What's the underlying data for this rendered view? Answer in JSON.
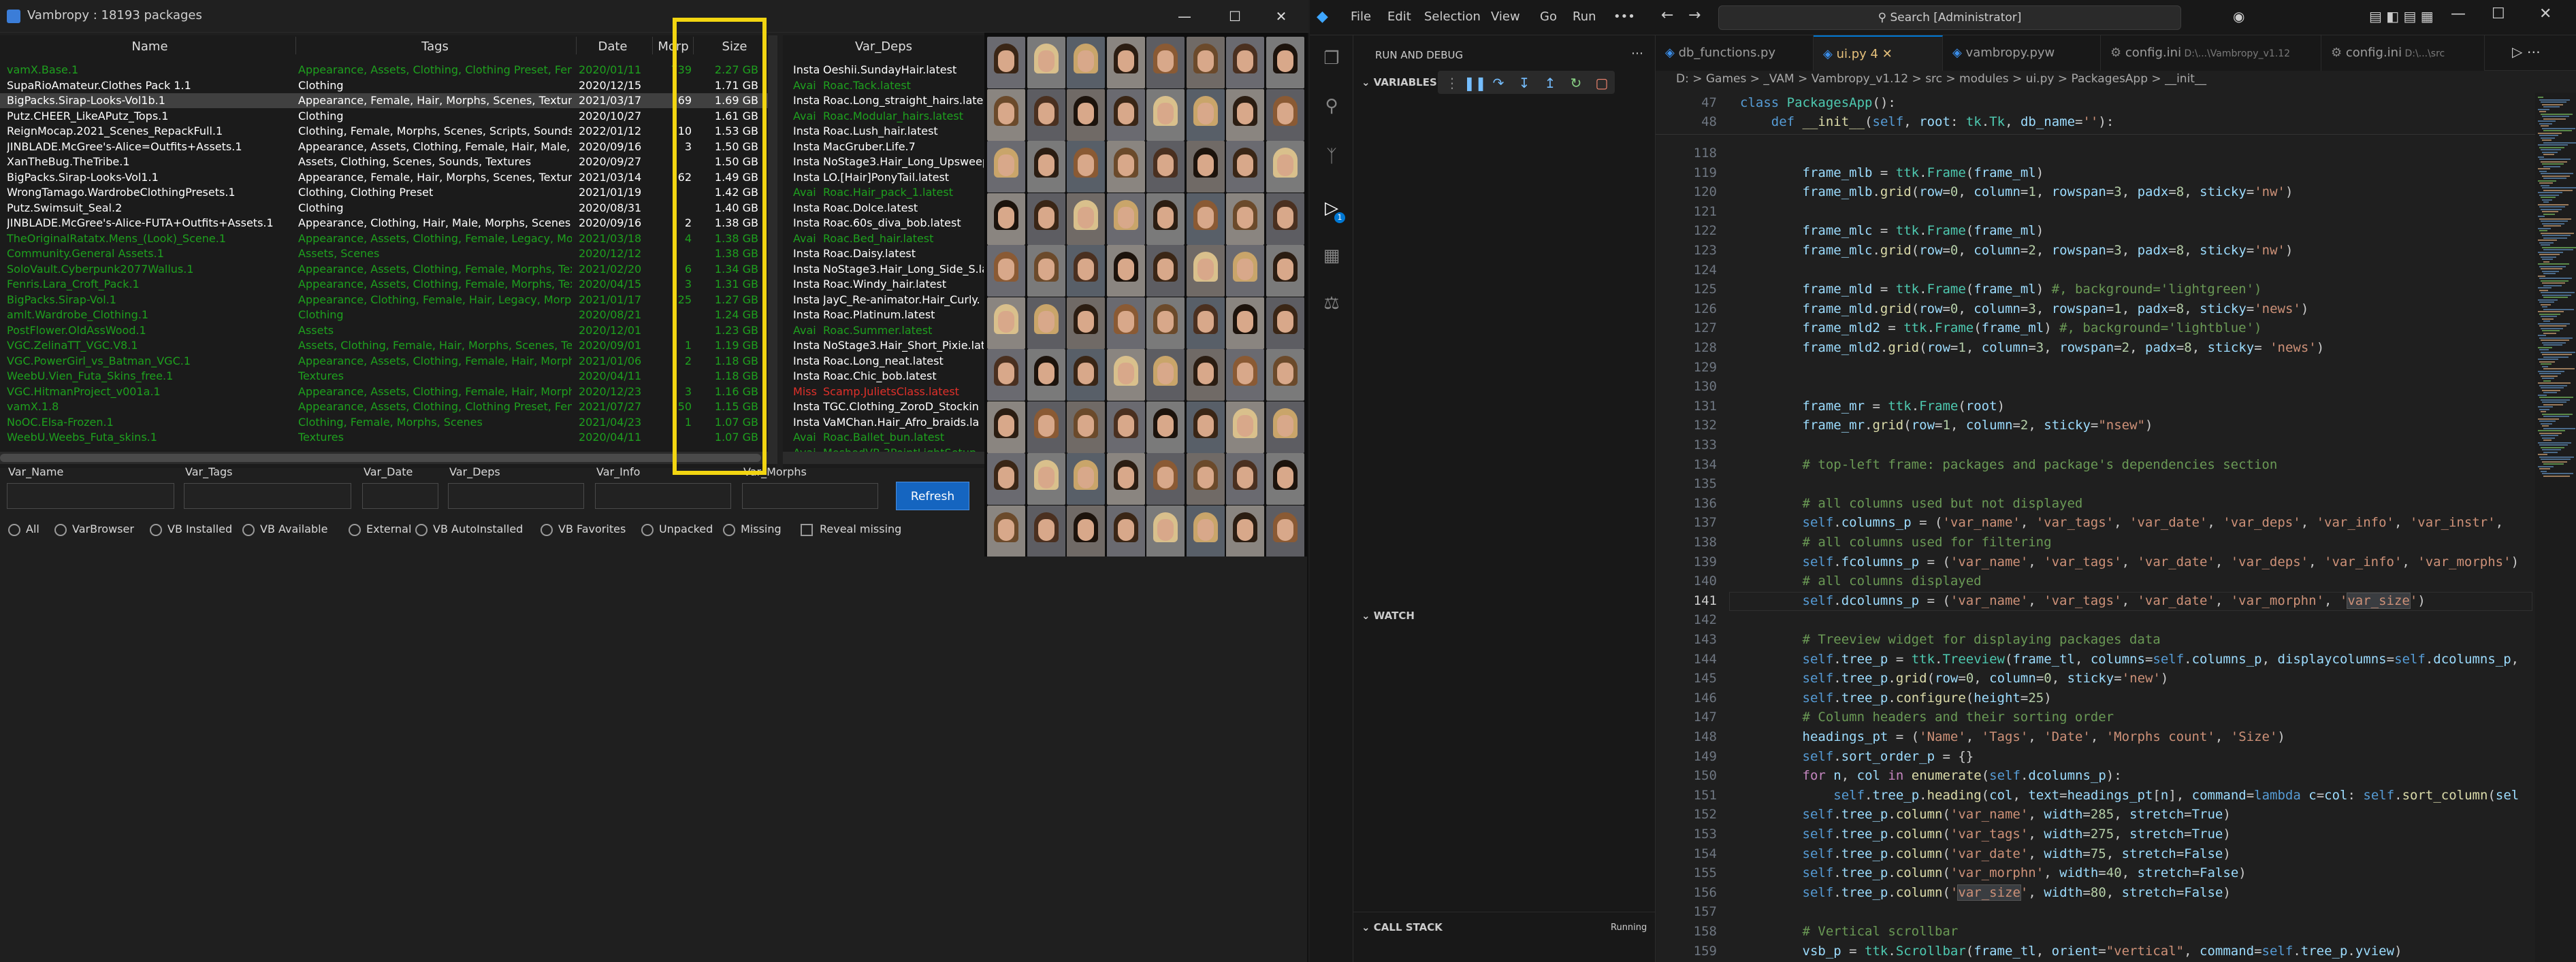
{
  "app": {
    "title": "Vambropy : 18193 packages",
    "window_buttons": [
      "—",
      "☐",
      "✕"
    ],
    "columns": [
      "Name",
      "Tags",
      "Date",
      "Morp",
      "Size"
    ],
    "rows": [
      {
        "name": "vamX.Base.1",
        "tags": "Appearance, Assets, Clothing, Clothing Preset, Fem",
        "date": "2020/01/11",
        "morph": "739",
        "size": "2.27 GB",
        "color": "green"
      },
      {
        "name": "SupaRioAmateur.Clothes Pack 1.1",
        "tags": "Clothing",
        "date": "2020/12/15",
        "morph": "",
        "size": "1.71 GB",
        "color": "white"
      },
      {
        "name": "BigPacks.Sirap-Looks-Vol1b.1",
        "tags": "Appearance, Female, Hair, Morphs, Scenes, Texture",
        "date": "2021/03/17",
        "morph": "69",
        "size": "1.69 GB",
        "color": "white",
        "selected": true
      },
      {
        "name": "Putz.CHEER_LikeAPutz_Tops.1",
        "tags": "Clothing",
        "date": "2020/10/27",
        "morph": "",
        "size": "1.61 GB",
        "color": "white"
      },
      {
        "name": "ReignMocap.2021_Scenes_RepackFull.1",
        "tags": "Clothing, Female, Morphs, Scenes, Scripts, Sounds",
        "date": "2022/01/12",
        "morph": "10",
        "size": "1.53 GB",
        "color": "white"
      },
      {
        "name": "JINBLADE.McGree's-Alice=Outfits+Assets.1",
        "tags": "Appearance, Assets, Clothing, Female, Hair, Male, I",
        "date": "2020/09/16",
        "morph": "3",
        "size": "1.50 GB",
        "color": "white"
      },
      {
        "name": "XanTheBug.TheTribe.1",
        "tags": "Assets, Clothing, Scenes, Sounds, Textures",
        "date": "2020/09/27",
        "morph": "",
        "size": "1.50 GB",
        "color": "white"
      },
      {
        "name": "BigPacks.Sirap-Looks-Vol1.1",
        "tags": "Appearance, Female, Hair, Morphs, Scenes, Texture",
        "date": "2021/03/14",
        "morph": "62",
        "size": "1.49 GB",
        "color": "white"
      },
      {
        "name": "WrongTamago.WardrobeClothingPresets.1",
        "tags": "Clothing, Clothing Preset",
        "date": "2021/01/19",
        "morph": "",
        "size": "1.42 GB",
        "color": "white"
      },
      {
        "name": "Putz.Swimsuit_Seal.2",
        "tags": "Clothing",
        "date": "2020/08/31",
        "morph": "",
        "size": "1.40 GB",
        "color": "white"
      },
      {
        "name": "JINBLADE.McGree's-Alice-FUTA+Outfits+Assets.1",
        "tags": "Appearance, Clothing, Hair, Male, Morphs, Scenes",
        "date": "2020/09/16",
        "morph": "2",
        "size": "1.38 GB",
        "color": "white"
      },
      {
        "name": "TheOriginalRatatx.Mens_(Look)_Scene.1",
        "tags": "Appearance, Assets, Clothing, Female, Legacy, Mor",
        "date": "2021/03/18",
        "morph": "4",
        "size": "1.38 GB",
        "color": "green"
      },
      {
        "name": "Community.General Assets.1",
        "tags": "Assets, Scenes",
        "date": "2020/12/12",
        "morph": "",
        "size": "1.38 GB",
        "color": "green"
      },
      {
        "name": "SoloVault.Cyberpunk2077Wallus.1",
        "tags": "Appearance, Assets, Clothing, Female, Morphs, Tex",
        "date": "2021/02/20",
        "morph": "6",
        "size": "1.34 GB",
        "color": "green"
      },
      {
        "name": "Fenris.Lara_Croft_Pack.1",
        "tags": "Appearance, Assets, Clothing, Female, Morphs, Textures",
        "date": "2020/04/15",
        "morph": "3",
        "size": "1.31 GB",
        "color": "green"
      },
      {
        "name": "BigPacks.Sirap-Vol.1",
        "tags": "Appearance, Clothing, Female, Hair, Legacy, Morp",
        "date": "2021/01/17",
        "morph": "25",
        "size": "1.27 GB",
        "color": "green"
      },
      {
        "name": "amlt.Wardrobe_Clothing.1",
        "tags": "Clothing",
        "date": "2020/08/21",
        "morph": "",
        "size": "1.24 GB",
        "color": "green"
      },
      {
        "name": "PostFlower.OldAssWood.1",
        "tags": "Assets",
        "date": "2020/12/01",
        "morph": "",
        "size": "1.23 GB",
        "color": "green"
      },
      {
        "name": "VGC.ZelinaTT_VGC.V8.1",
        "tags": "Assets, Clothing, Female, Hair, Morphs, Scenes, Tex",
        "date": "2020/09/01",
        "morph": "1",
        "size": "1.19 GB",
        "color": "green"
      },
      {
        "name": "VGC.PowerGirl_vs_Batman_VGC.1",
        "tags": "Appearance, Assets, Clothing, Female, Hair, Morphs, Scen",
        "date": "2021/01/06",
        "morph": "2",
        "size": "1.18 GB",
        "color": "green"
      },
      {
        "name": "WeebU.Vien_Futa_Skins_free.1",
        "tags": "Textures",
        "date": "2020/04/11",
        "morph": "",
        "size": "1.18 GB",
        "color": "green"
      },
      {
        "name": "VGC.HitmanProject_v001a.1",
        "tags": "Appearance, Assets, Clothing, Female, Hair, Morphs, Scen",
        "date": "2020/12/23",
        "morph": "3",
        "size": "1.16 GB",
        "color": "green"
      },
      {
        "name": "vamX.1.8",
        "tags": "Appearance, Assets, Clothing, Clothing Preset, Fem",
        "date": "2021/07/27",
        "morph": "50",
        "size": "1.15 GB",
        "color": "green"
      },
      {
        "name": "NoOC.Elsa-Frozen.1",
        "tags": "Clothing, Female, Morphs, Scenes",
        "date": "2021/04/23",
        "morph": "1",
        "size": "1.07 GB",
        "color": "green"
      },
      {
        "name": "WeebU.Weebs_Futa_skins.1",
        "tags": "Textures",
        "date": "2020/04/11",
        "morph": "",
        "size": "1.07 GB",
        "color": "green"
      }
    ],
    "deps_header": "Var_Deps",
    "deps": [
      {
        "status": "Insta",
        "name": "Oeshii.SundayHair.latest",
        "color": "white"
      },
      {
        "status": "Avai",
        "name": "Roac.Tack.latest",
        "color": "green"
      },
      {
        "status": "Insta",
        "name": "Roac.Long_straight_hairs.latest",
        "color": "white"
      },
      {
        "status": "Avai",
        "name": "Roac.Modular_hairs.latest",
        "color": "green"
      },
      {
        "status": "Insta",
        "name": "Roac.Lush_hair.latest",
        "color": "white"
      },
      {
        "status": "Insta",
        "name": "MacGruber.Life.7",
        "color": "white"
      },
      {
        "status": "Insta",
        "name": "NoStage3.Hair_Long_Upsweep",
        "color": "white"
      },
      {
        "status": "Insta",
        "name": "LO.[Hair]PonyTail.latest",
        "color": "white"
      },
      {
        "status": "Avai",
        "name": "Roac.Hair_pack_1.latest",
        "color": "green"
      },
      {
        "status": "Insta",
        "name": "Roac.Dolce.latest",
        "color": "white"
      },
      {
        "status": "Insta",
        "name": "Roac.60s_diva_bob.latest",
        "color": "white"
      },
      {
        "status": "Avai",
        "name": "Roac.Bed_hair.latest",
        "color": "green"
      },
      {
        "status": "Insta",
        "name": "Roac.Daisy.latest",
        "color": "white"
      },
      {
        "status": "Insta",
        "name": "NoStage3.Hair_Long_Side_S.la",
        "color": "white"
      },
      {
        "status": "Insta",
        "name": "Roac.Windy_hair.latest",
        "color": "white"
      },
      {
        "status": "Insta",
        "name": "JayC_Re-animator.Hair_Curly.",
        "color": "white"
      },
      {
        "status": "Insta",
        "name": "Roac.Platinum.latest",
        "color": "white"
      },
      {
        "status": "Avai",
        "name": "Roac.Summer.latest",
        "color": "green"
      },
      {
        "status": "Insta",
        "name": "NoStage3.Hair_Short_Pixie.lat",
        "color": "white"
      },
      {
        "status": "Insta",
        "name": "Roac.Long_neat.latest",
        "color": "white"
      },
      {
        "status": "Insta",
        "name": "Roac.Chic_bob.latest",
        "color": "white"
      },
      {
        "status": "Miss",
        "name": "Scamp.JulietsClass.latest",
        "color": "red"
      },
      {
        "status": "Insta",
        "name": "TGC.Clothing_ZoroD_Stockin",
        "color": "white"
      },
      {
        "status": "Insta",
        "name": "VaMChan.Hair_Afro_braids.la",
        "color": "white"
      },
      {
        "status": "Avai",
        "name": "Roac.Ballet_bun.latest",
        "color": "green"
      },
      {
        "status": "Avai",
        "name": "MeshedVR.3PointLightSetup.",
        "color": "green"
      }
    ],
    "filters": {
      "labels": [
        "Var_Name",
        "Var_Tags",
        "Var_Date",
        "Var_Deps",
        "Var_Info",
        "Var_Morphs"
      ],
      "refresh_label": "Refresh",
      "radios": [
        "All",
        "VarBrowser",
        "VB Installed",
        "VB Available",
        "External",
        "VB AutoInstalled",
        "VB Favorites",
        "Unpacked",
        "Missing"
      ],
      "checkbox": "Reveal missing"
    }
  },
  "vscode": {
    "menu": [
      "File",
      "Edit",
      "Selection",
      "View",
      "Go",
      "Run",
      "•••"
    ],
    "search_placeholder": "Search [Administrator]",
    "run_and_debug": "RUN AND DEBUG",
    "variables": "VARIABLES",
    "watch": "WATCH",
    "call_stack": "CALL STACK",
    "call_stack_status": "Running",
    "tabs": [
      {
        "label": "db_functions.py",
        "active": false
      },
      {
        "label": "ui.py",
        "active": true,
        "badge": "4"
      },
      {
        "label": "vambropy.pyw",
        "active": false
      },
      {
        "label": "config.ini",
        "sub": "D:\\...\\Vambropy_v1.12",
        "active": false
      },
      {
        "label": "config.ini",
        "sub": "D:\\...\\src",
        "active": false
      }
    ],
    "breadcrumb": "D: > Games > _VAM > Vambropy_v1.12 > src > modules > ui.py > PackagesApp > __init__",
    "current_line": "141",
    "sticky_lines": [
      {
        "n": "47",
        "code": "class PackagesApp():"
      },
      {
        "n": "48",
        "code": "    def __init__(self, root: tk.Tk, db_name=''):"
      }
    ],
    "lines": [
      {
        "n": "118",
        "code": ""
      },
      {
        "n": "119",
        "code": "        frame_mlb = ttk.Frame(frame_ml)"
      },
      {
        "n": "120",
        "code": "        frame_mlb.grid(row=0, column=1, rowspan=3, padx=8, sticky='nw')"
      },
      {
        "n": "121",
        "code": ""
      },
      {
        "n": "122",
        "code": "        frame_mlc = ttk.Frame(frame_ml)"
      },
      {
        "n": "123",
        "code": "        frame_mlc.grid(row=0, column=2, rowspan=3, padx=8, sticky='nw')"
      },
      {
        "n": "124",
        "code": ""
      },
      {
        "n": "125",
        "code": "        frame_mld = ttk.Frame(frame_ml) #, background='lightgreen')"
      },
      {
        "n": "126",
        "code": "        frame_mld.grid(row=0, column=3, rowspan=1, padx=8, sticky='news')"
      },
      {
        "n": "127",
        "code": "        frame_mld2 = ttk.Frame(frame_ml) #, background='lightblue')"
      },
      {
        "n": "128",
        "code": "        frame_mld2.grid(row=1, column=3, rowspan=2, padx=8, sticky= 'news')"
      },
      {
        "n": "129",
        "code": ""
      },
      {
        "n": "130",
        "code": ""
      },
      {
        "n": "131",
        "code": "        frame_mr = ttk.Frame(root)"
      },
      {
        "n": "132",
        "code": "        frame_mr.grid(row=1, column=2, sticky=\"nsew\")"
      },
      {
        "n": "133",
        "code": ""
      },
      {
        "n": "134",
        "code": "        # top-left frame: packages and package's dependencies section"
      },
      {
        "n": "135",
        "code": ""
      },
      {
        "n": "136",
        "code": "        # all columns used but not displayed"
      },
      {
        "n": "137",
        "code": "        self.columns_p = ('var_name', 'var_tags', 'var_date', 'var_deps', 'var_info', 'var_instr', '"
      },
      {
        "n": "138",
        "code": "        # all columns used for filtering"
      },
      {
        "n": "139",
        "code": "        self.fcolumns_p = ('var_name', 'var_tags', 'var_date', 'var_deps', 'var_info', 'var_morphs')"
      },
      {
        "n": "140",
        "code": "        # all columns displayed"
      },
      {
        "n": "141",
        "code": "        self.dcolumns_p = ('var_name', 'var_tags', 'var_date', 'var_morphn', 'var_size')"
      },
      {
        "n": "142",
        "code": ""
      },
      {
        "n": "143",
        "code": "        # Treeview widget for displaying packages data"
      },
      {
        "n": "144",
        "code": "        self.tree_p = ttk.Treeview(frame_tl, columns=self.columns_p, displaycolumns=self.dcolumns_p,"
      },
      {
        "n": "145",
        "code": "        self.tree_p.grid(row=0, column=0, sticky='new')"
      },
      {
        "n": "146",
        "code": "        self.tree_p.configure(height=25)"
      },
      {
        "n": "147",
        "code": "        # Column headers and their sorting order"
      },
      {
        "n": "148",
        "code": "        headings_pt = ('Name', 'Tags', 'Date', 'Morphs count', 'Size')"
      },
      {
        "n": "149",
        "code": "        self.sort_order_p = {}"
      },
      {
        "n": "150",
        "code": "        for n, col in enumerate(self.dcolumns_p):"
      },
      {
        "n": "151",
        "code": "            self.tree_p.heading(col, text=headings_pt[n], command=lambda c=col: self.sort_column(sel"
      },
      {
        "n": "152",
        "code": "        self.tree_p.column('var_name', width=285, stretch=True)"
      },
      {
        "n": "153",
        "code": "        self.tree_p.column('var_tags', width=275, stretch=True)"
      },
      {
        "n": "154",
        "code": "        self.tree_p.column('var_date', width=75, stretch=False)"
      },
      {
        "n": "155",
        "code": "        self.tree_p.column('var_morphn', width=40, stretch=False)"
      },
      {
        "n": "156",
        "code": "        self.tree_p.column('var_size', width=80, stretch=False)"
      },
      {
        "n": "157",
        "code": ""
      },
      {
        "n": "158",
        "code": "        # Vertical scrollbar"
      },
      {
        "n": "159",
        "code": "        vsb_p = ttk.Scrollbar(frame_tl, orient=\"vertical\", command=self.tree_p.yview)"
      }
    ]
  },
  "colors": {
    "highlight": "#f2d511",
    "installed": "#ffffff",
    "available": "#1ea01e",
    "missing": "#e0302a",
    "accent": "#1565c0"
  }
}
